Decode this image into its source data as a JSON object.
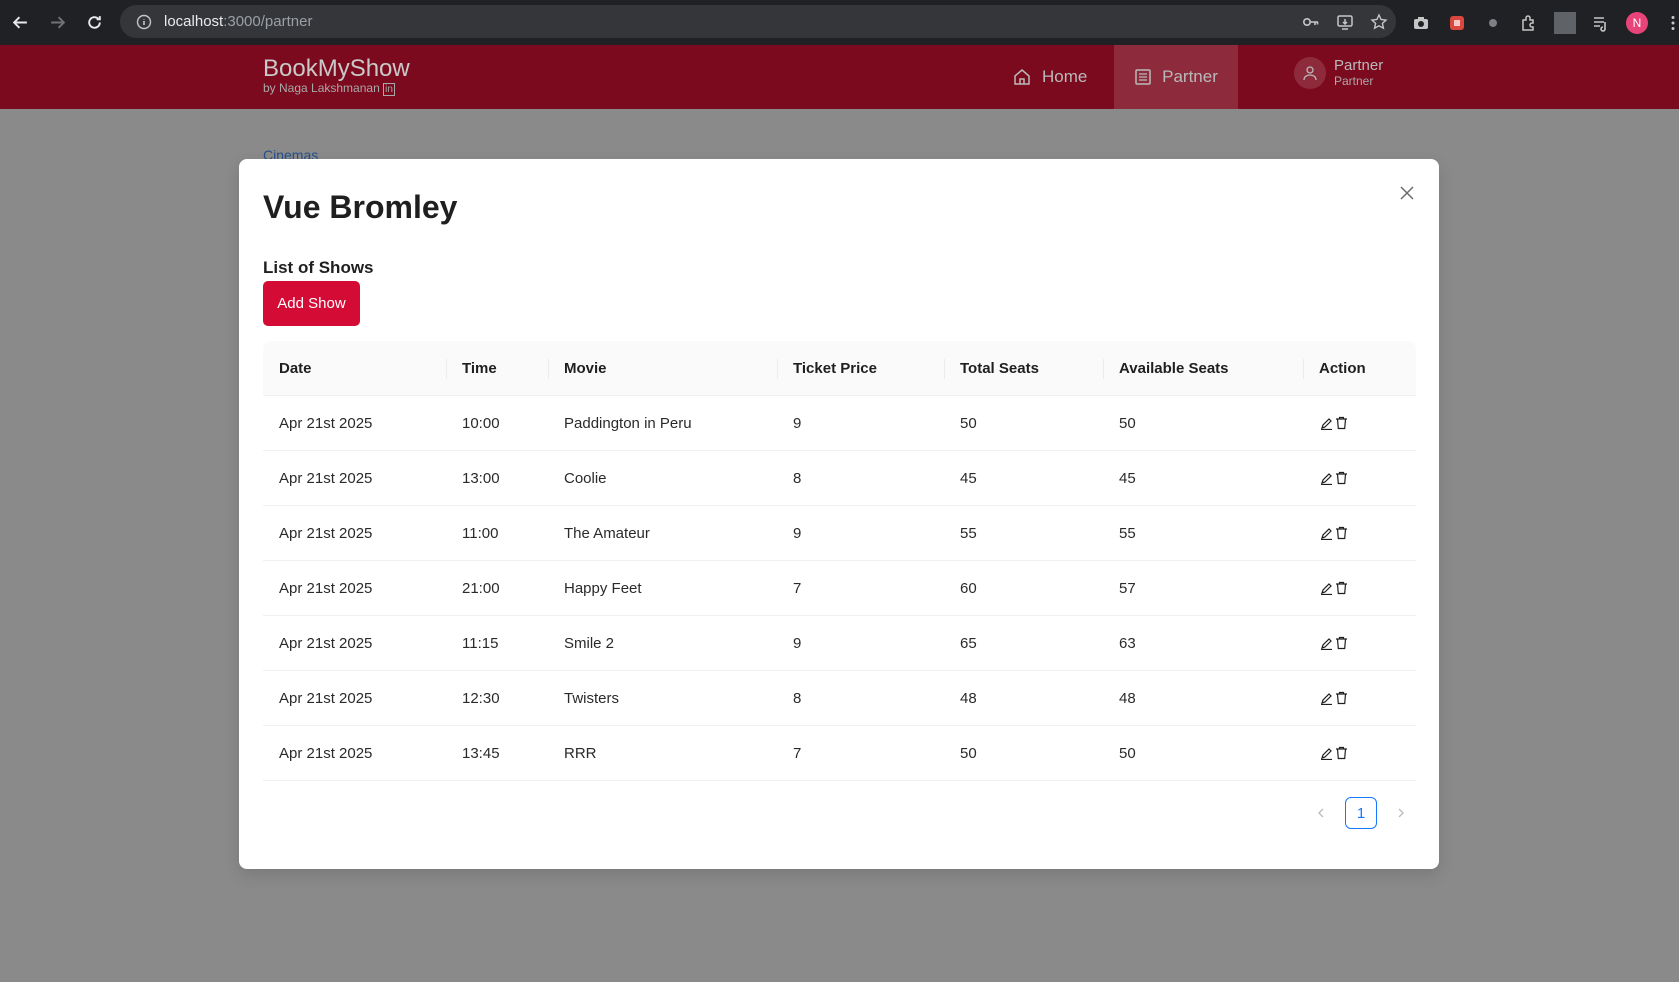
{
  "browser": {
    "url_host": "localhost",
    "url_path": ":3000/partner",
    "profile_initial": "N"
  },
  "header": {
    "brand_title": "BookMyShow",
    "brand_subtitle": "by Naga Lakshmanan",
    "nav_home": "Home",
    "nav_partner": "Partner",
    "user_name": "Partner",
    "user_role": "Partner"
  },
  "background": {
    "breadcrumb_link": "Cinemas"
  },
  "modal": {
    "title": "Vue Bromley",
    "list_label": "List of Shows",
    "add_button": "Add Show",
    "columns": [
      "Date",
      "Time",
      "Movie",
      "Ticket Price",
      "Total Seats",
      "Available Seats",
      "Action"
    ],
    "rows": [
      [
        "Apr 21st 2025",
        "10:00",
        "Paddington in Peru",
        "9",
        "50",
        "50"
      ],
      [
        "Apr 21st 2025",
        "13:00",
        "Coolie",
        "8",
        "45",
        "45"
      ],
      [
        "Apr 21st 2025",
        "11:00",
        "The Amateur",
        "9",
        "55",
        "55"
      ],
      [
        "Apr 21st 2025",
        "21:00",
        "Happy Feet",
        "7",
        "60",
        "57"
      ],
      [
        "Apr 21st 2025",
        "11:15",
        "Smile 2",
        "9",
        "65",
        "63"
      ],
      [
        "Apr 21st 2025",
        "12:30",
        "Twisters",
        "8",
        "48",
        "48"
      ],
      [
        "Apr 21st 2025",
        "13:45",
        "RRR",
        "7",
        "50",
        "50"
      ]
    ],
    "current_page": "1"
  },
  "colors": {
    "brand": "#d40b35",
    "header_bg": "#7c0a1e",
    "pager_active": "#1677ff"
  },
  "icons": {
    "row_actions": [
      "edit-icon",
      "delete-icon"
    ]
  }
}
